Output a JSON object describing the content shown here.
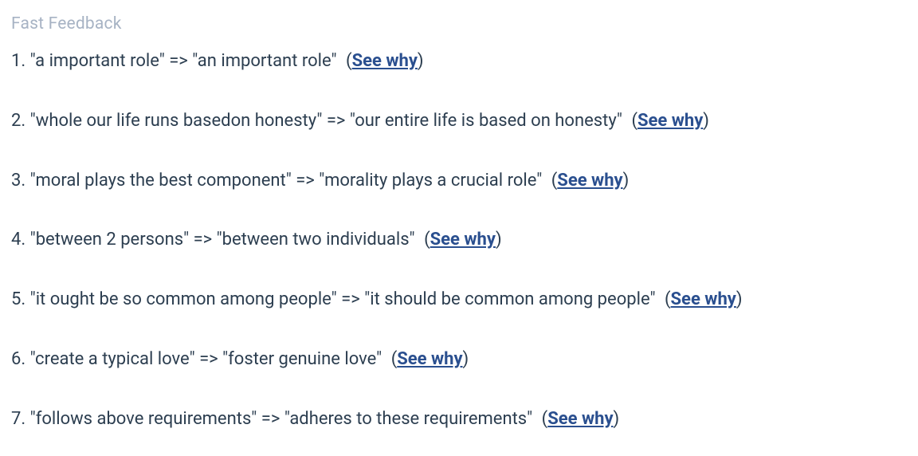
{
  "header": "Fast Feedback",
  "link_label": "See why",
  "items": [
    {
      "number": "1.",
      "text": "\"a important role\" => \"an important role\""
    },
    {
      "number": "2.",
      "text": "\"whole our life runs basedon honesty\" => \"our entire life is based on honesty\""
    },
    {
      "number": "3.",
      "text": "\"moral plays the best component\" => \"morality plays a crucial role\""
    },
    {
      "number": "4.",
      "text": "\"between 2 persons\" => \"between two individuals\""
    },
    {
      "number": "5.",
      "text": "\"it ought be so common among people\" => \"it should be common among people\""
    },
    {
      "number": "6.",
      "text": "\"create a typical love\" => \"foster genuine love\""
    },
    {
      "number": "7.",
      "text": "\"follows above requirements\" => \"adheres to these requirements\""
    }
  ]
}
